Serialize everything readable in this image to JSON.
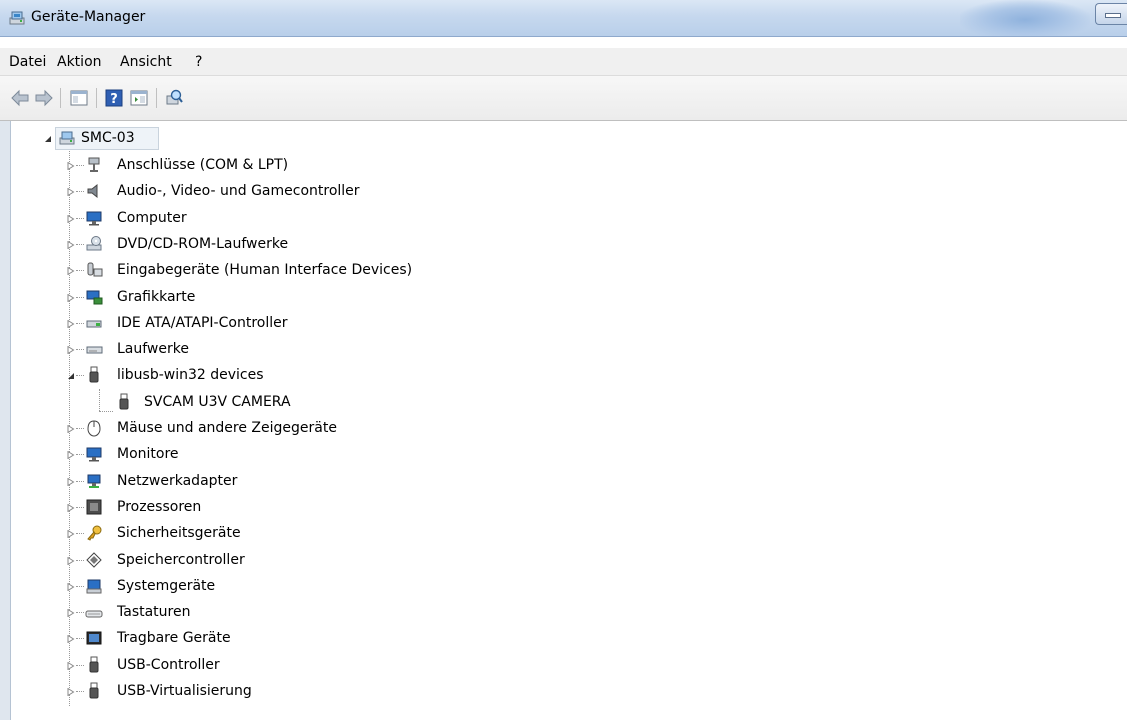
{
  "window": {
    "title": "Geräte-Manager"
  },
  "menu": {
    "items": [
      "Datei",
      "Aktion",
      "Ansicht",
      "?"
    ]
  },
  "tree": {
    "root": "SMC-03",
    "categories": [
      "Anschlüsse (COM & LPT)",
      "Audio-, Video- und Gamecontroller",
      "Computer",
      "DVD/CD-ROM-Laufwerke",
      "Eingabegeräte (Human Interface Devices)",
      "Grafikkarte",
      "IDE ATA/ATAPI-Controller",
      "Laufwerke",
      "libusb-win32 devices",
      "SVCAM U3V CAMERA",
      "Mäuse und andere Zeigegeräte",
      "Monitore",
      "Netzwerkadapter",
      "Prozessoren",
      "Sicherheitsgeräte",
      "Speichercontroller",
      "Systemgeräte",
      "Tastaturen",
      "Tragbare Geräte",
      "USB-Controller",
      "USB-Virtualisierung"
    ]
  },
  "colors": {
    "titlebar": "#c6d8ee",
    "menubar": "#f0f0f0",
    "toolbar": "#ececec"
  }
}
